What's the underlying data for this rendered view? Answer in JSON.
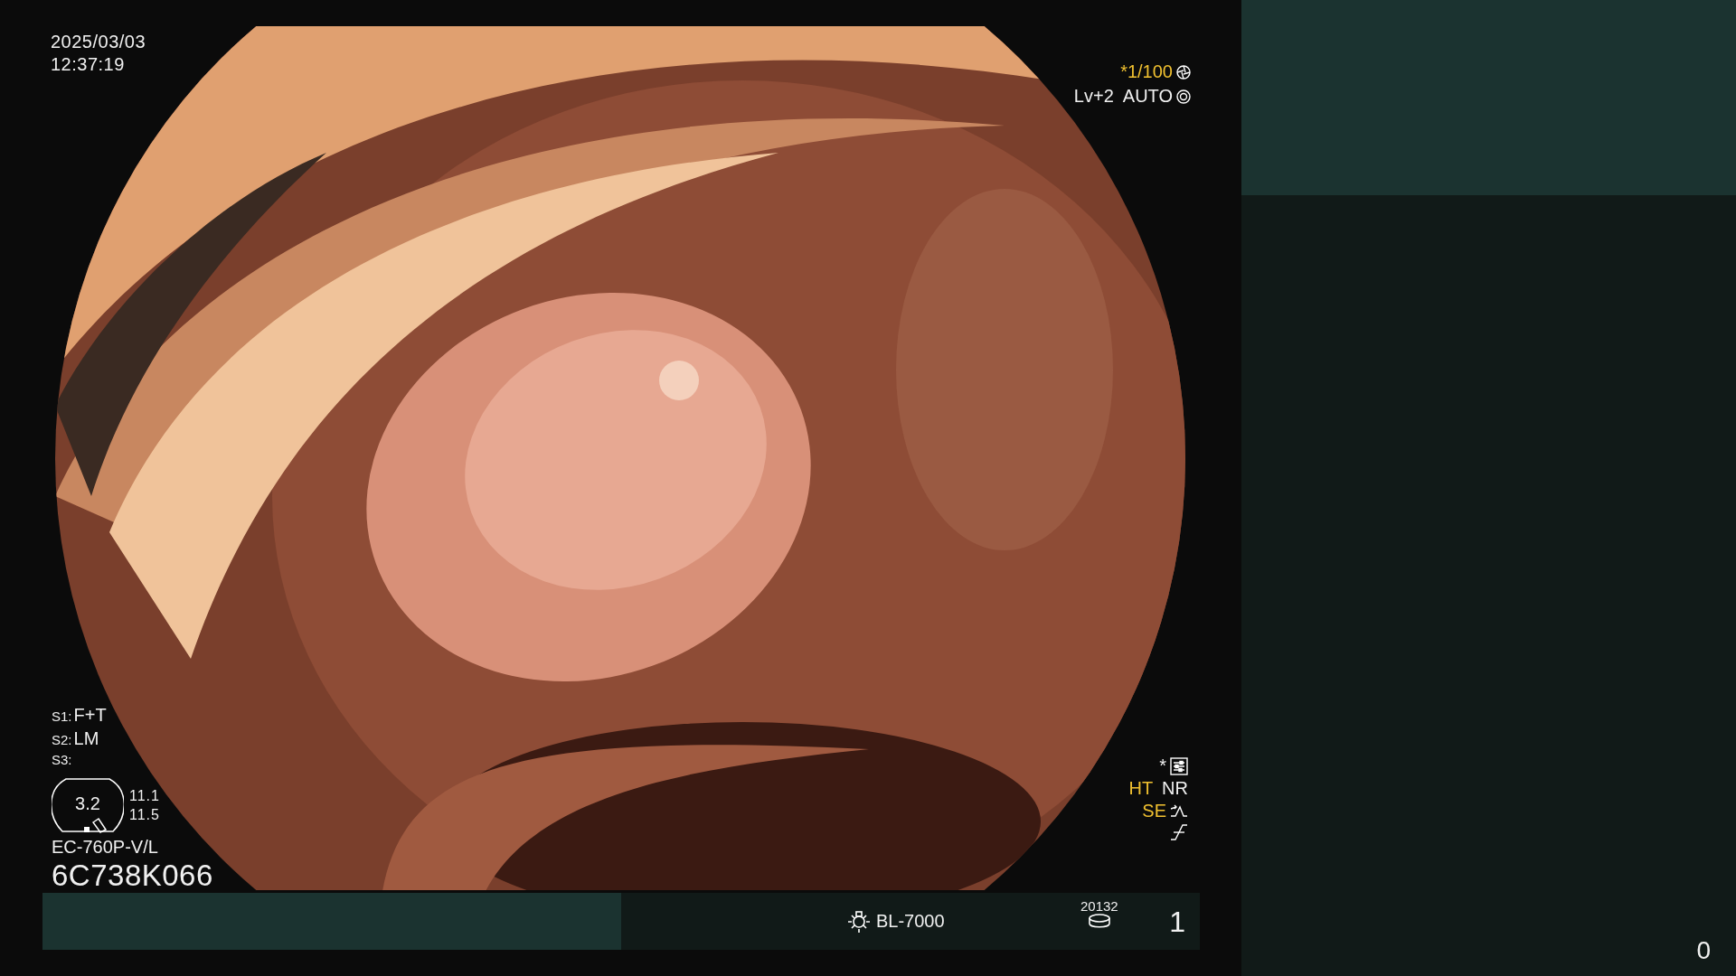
{
  "date": "2025/03/03",
  "time": "12:37:19",
  "shutter": "*1/100",
  "exposure": {
    "level_text": "Lv+2",
    "mode": "AUTO"
  },
  "settings": [
    {
      "label": "S1:",
      "value": "F+T"
    },
    {
      "label": "S2:",
      "value": "LM"
    },
    {
      "label": "S3:"
    }
  ],
  "gauge": {
    "value": "3.2",
    "readings": [
      "11.1",
      "11.5"
    ]
  },
  "scope_model": "EC-760P-V/L",
  "serial": "6C738K066",
  "enhancements": {
    "asterisk": "*",
    "ht": "HT",
    "nr": "NR",
    "se": "SE"
  },
  "status_bar": {
    "light_source": "BL-7000",
    "counter": "20132",
    "number": "1"
  },
  "side_panel": {
    "number": "0"
  }
}
